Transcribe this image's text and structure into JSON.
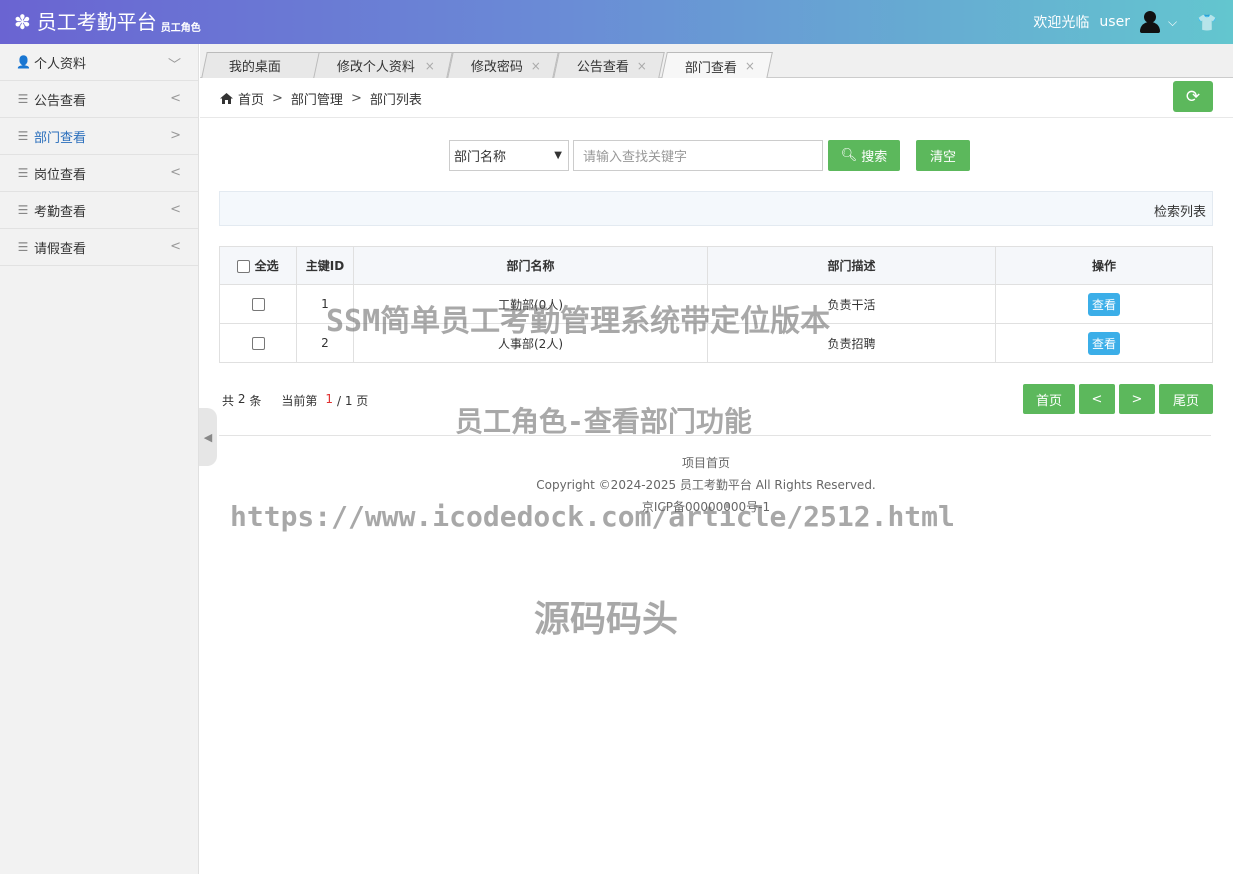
{
  "header": {
    "logo_icon": "✽",
    "title": "员工考勤平台",
    "role": "员工角色",
    "welcome": "欢迎光临",
    "username": "user",
    "chevron": "⌵",
    "shirt_icon": "👕"
  },
  "sidebar": {
    "items": [
      {
        "label": "个人资料",
        "icon": "user-icon",
        "arrow": "﹀",
        "active": false
      },
      {
        "label": "公告查看",
        "icon": "list-icon",
        "arrow": "<",
        "active": false
      },
      {
        "label": "部门查看",
        "icon": "list-icon",
        "arrow": ">",
        "active": true
      },
      {
        "label": "岗位查看",
        "icon": "list-icon",
        "arrow": "<",
        "active": false
      },
      {
        "label": "考勤查看",
        "icon": "list-icon",
        "arrow": "<",
        "active": false
      },
      {
        "label": "请假查看",
        "icon": "list-icon",
        "arrow": "<",
        "active": false
      }
    ]
  },
  "tabs": [
    {
      "label": "我的桌面",
      "closable": false,
      "active": false
    },
    {
      "label": "修改个人资料",
      "closable": true,
      "active": false
    },
    {
      "label": "修改密码",
      "closable": true,
      "active": false
    },
    {
      "label": "公告查看",
      "closable": true,
      "active": false
    },
    {
      "label": "部门查看",
      "closable": true,
      "active": true
    }
  ],
  "tab_close": "×",
  "breadcrumb": {
    "home": "首页",
    "sep": ">",
    "level1": "部门管理",
    "level2": "部门列表"
  },
  "search": {
    "field": "部门名称",
    "placeholder": "请输入查找关键字",
    "search_label": "搜索",
    "clear_label": "清空"
  },
  "list_title": "检索列表",
  "table": {
    "headers": {
      "select_all": "全选",
      "id": "主键ID",
      "name": "部门名称",
      "desc": "部门描述",
      "action": "操作"
    },
    "rows": [
      {
        "id": "1",
        "name": "工勤部(0人)",
        "desc": "负责干活",
        "action": "查看"
      },
      {
        "id": "2",
        "name": "人事部(2人)",
        "desc": "负责招聘",
        "action": "查看"
      }
    ]
  },
  "pagination": {
    "total_prefix": "共",
    "total": "2",
    "total_suffix": "条",
    "current_prefix": "当前第",
    "current": "1",
    "pages_text": "/ 1 页",
    "first": "首页",
    "prev": "<",
    "next": ">",
    "last": "尾页"
  },
  "footer": {
    "link": "项目首页",
    "copyright": "Copyright ©2024-2025 员工考勤平台 All Rights Reserved.",
    "icp": "京ICP备00000000号-1"
  },
  "watermarks": {
    "line1": "SSM简单员工考勤管理系统带定位版本",
    "line2": "员工角色-查看部门功能",
    "line3": "https://www.icodedock.com/article/2512.html",
    "line4": "源码码头"
  },
  "colors": {
    "header_start": "#6a64d2",
    "header_end": "#63c6cf",
    "green": "#5cb85c",
    "view_blue": "#3baee8",
    "active_link": "#2b6fbc"
  }
}
